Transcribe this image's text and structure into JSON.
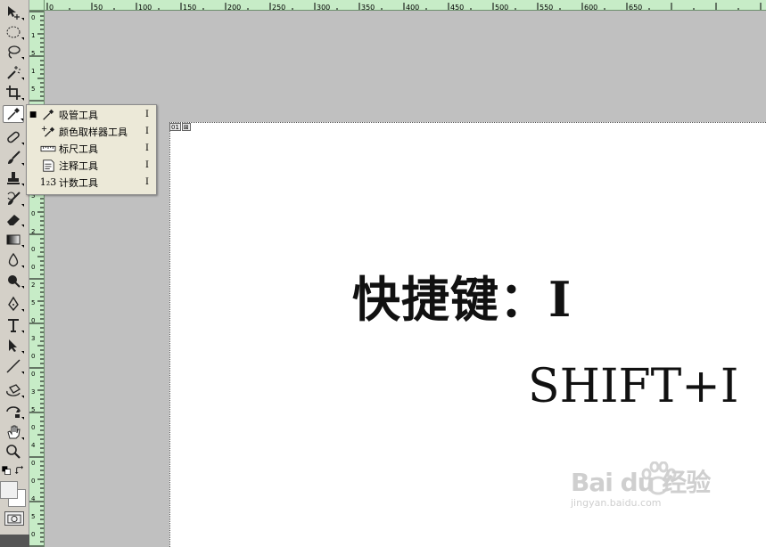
{
  "tools": [
    {
      "name": "move-tool",
      "icon": "move-icon"
    },
    {
      "name": "marquee-tool",
      "icon": "ellipse-marquee-icon"
    },
    {
      "name": "lasso-tool",
      "icon": "lasso-icon"
    },
    {
      "name": "magic-wand-tool",
      "icon": "magic-wand-icon"
    },
    {
      "name": "crop-tool",
      "icon": "crop-icon"
    },
    {
      "name": "eyedropper-tool",
      "icon": "eyedropper-icon"
    },
    {
      "name": "healing-brush-tool",
      "icon": "healing-icon"
    },
    {
      "name": "brush-tool",
      "icon": "brush-icon"
    },
    {
      "name": "stamp-tool",
      "icon": "stamp-icon"
    },
    {
      "name": "history-brush-tool",
      "icon": "history-brush-icon"
    },
    {
      "name": "eraser-tool",
      "icon": "eraser-icon"
    },
    {
      "name": "gradient-tool",
      "icon": "gradient-icon"
    },
    {
      "name": "blur-tool",
      "icon": "blur-icon"
    },
    {
      "name": "dodge-tool",
      "icon": "dodge-icon"
    },
    {
      "name": "pen-tool",
      "icon": "pen-icon"
    },
    {
      "name": "type-tool",
      "icon": "type-icon"
    },
    {
      "name": "path-selection-tool",
      "icon": "path-selection-icon"
    },
    {
      "name": "line-tool",
      "icon": "line-icon"
    },
    {
      "name": "3d-rotate-tool",
      "icon": "3d-rotate-icon"
    },
    {
      "name": "3d-orbit-tool",
      "icon": "3d-orbit-icon"
    },
    {
      "name": "hand-tool",
      "icon": "hand-icon"
    },
    {
      "name": "zoom-tool",
      "icon": "zoom-icon"
    }
  ],
  "ruler": {
    "horizontal_labels": [
      "0",
      "50",
      "100",
      "150",
      "200",
      "250",
      "300",
      "350",
      "400",
      "450",
      "500",
      "550",
      "600",
      "650"
    ],
    "vertical_labels": [
      "0",
      "1",
      "5",
      "1",
      "5",
      "0",
      "1",
      "0",
      "0",
      "1",
      "5",
      "0",
      "2",
      "0",
      "0",
      "2",
      "5",
      "0",
      "3",
      "0",
      "0",
      "3",
      "5",
      "0",
      "4",
      "0",
      "0",
      "4",
      "5",
      "0"
    ]
  },
  "document": {
    "tag_number": "01",
    "tag_close": "⊠",
    "heading": "快捷键：I",
    "shortcut": "SHIFT+I"
  },
  "flyout": {
    "items": [
      {
        "label": "吸管工具",
        "key": "I",
        "icon": "eyedropper-icon",
        "selected": true
      },
      {
        "label": "颜色取样器工具",
        "key": "I",
        "icon": "color-sampler-icon",
        "selected": false
      },
      {
        "label": "标尺工具",
        "key": "I",
        "icon": "ruler-icon",
        "selected": false
      },
      {
        "label": "注释工具",
        "key": "I",
        "icon": "note-icon",
        "selected": false
      },
      {
        "label": "计数工具",
        "key": "I",
        "icon": "count-icon",
        "selected": false
      }
    ],
    "selected_marker": "■",
    "count_icon_text": "1₂3"
  },
  "watermark": {
    "logo": "Bai du 经验",
    "url": "jingyan.baidu.com"
  },
  "colors": {
    "ruler_bg": "#c7ecc7",
    "workspace_bg": "#c0c0c0",
    "toolbar_bg": "#d4d0c8",
    "flyout_bg": "#ece9d8"
  }
}
